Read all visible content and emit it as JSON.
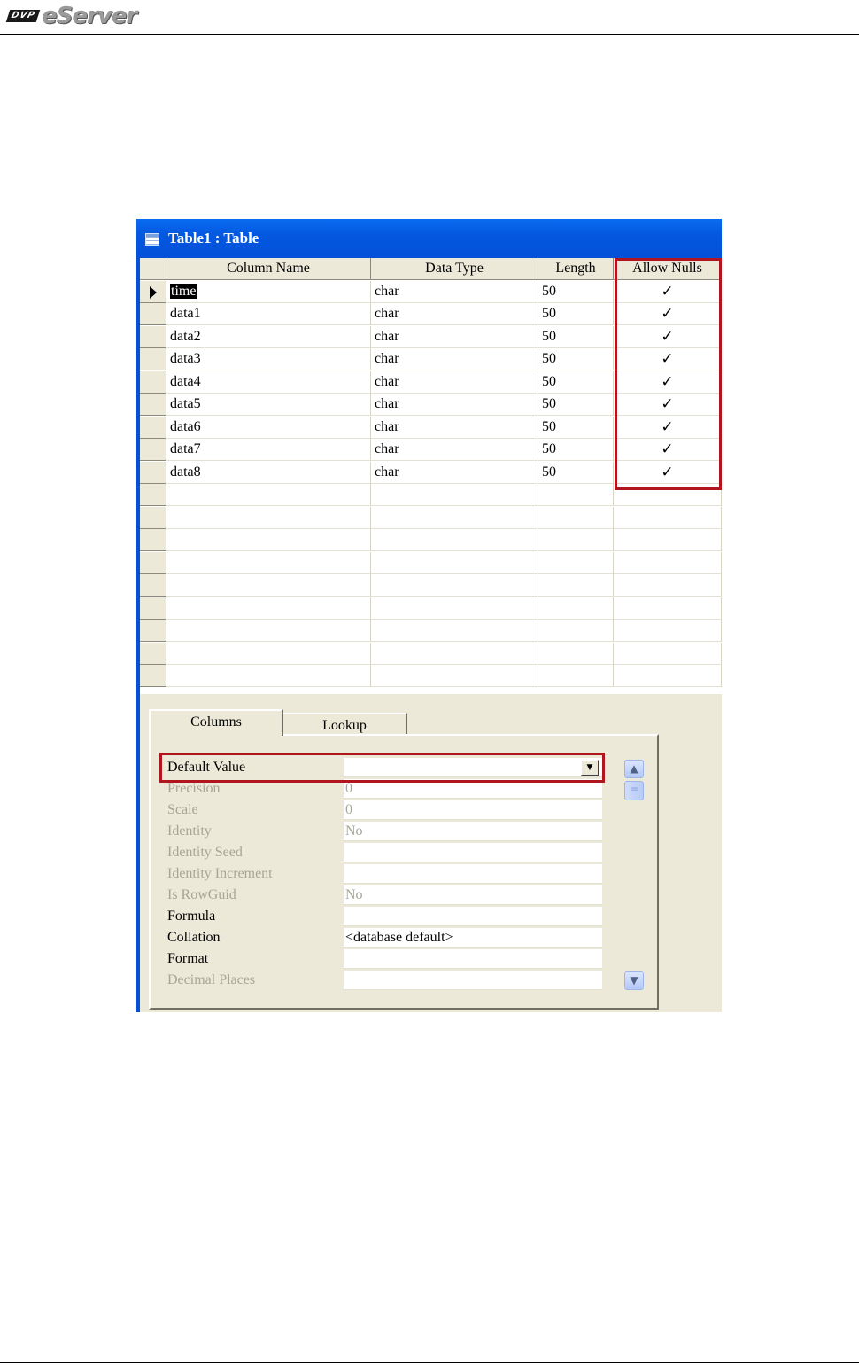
{
  "header": {
    "logo_badge": "DVP",
    "logo_text": "eServer"
  },
  "window": {
    "title": "Table1 : Table"
  },
  "grid": {
    "columns": [
      "Column Name",
      "Data Type",
      "Length",
      "Allow Nulls"
    ],
    "rows": [
      {
        "name": "time",
        "type": "char",
        "length": "50",
        "allow_nulls": "✓"
      },
      {
        "name": "data1",
        "type": "char",
        "length": "50",
        "allow_nulls": "✓"
      },
      {
        "name": "data2",
        "type": "char",
        "length": "50",
        "allow_nulls": "✓"
      },
      {
        "name": "data3",
        "type": "char",
        "length": "50",
        "allow_nulls": "✓"
      },
      {
        "name": "data4",
        "type": "char",
        "length": "50",
        "allow_nulls": "✓"
      },
      {
        "name": "data5",
        "type": "char",
        "length": "50",
        "allow_nulls": "✓"
      },
      {
        "name": "data6",
        "type": "char",
        "length": "50",
        "allow_nulls": "✓"
      },
      {
        "name": "data7",
        "type": "char",
        "length": "50",
        "allow_nulls": "✓"
      },
      {
        "name": "data8",
        "type": "char",
        "length": "50",
        "allow_nulls": "✓"
      }
    ],
    "current_row_index": 0
  },
  "properties": {
    "tabs": [
      "Columns",
      "Lookup"
    ],
    "active_tab": "Columns",
    "rows": [
      {
        "label": "Default Value",
        "value": "",
        "disabled": false
      },
      {
        "label": "Precision",
        "value": "0",
        "disabled": true
      },
      {
        "label": "Scale",
        "value": "0",
        "disabled": true
      },
      {
        "label": "Identity",
        "value": "No",
        "disabled": true
      },
      {
        "label": "Identity Seed",
        "value": "",
        "disabled": true
      },
      {
        "label": "Identity Increment",
        "value": "",
        "disabled": true
      },
      {
        "label": "Is RowGuid",
        "value": "No",
        "disabled": true
      },
      {
        "label": "Formula",
        "value": "",
        "disabled": false
      },
      {
        "label": "Collation",
        "value": "<database default>",
        "disabled": false
      },
      {
        "label": "Format",
        "value": "",
        "disabled": false
      },
      {
        "label": "Decimal Places",
        "value": "",
        "disabled": true
      }
    ]
  },
  "colors": {
    "titlebar": "#0450d8",
    "highlight_box": "#b1151e",
    "panel_bg": "#ece9d8"
  }
}
